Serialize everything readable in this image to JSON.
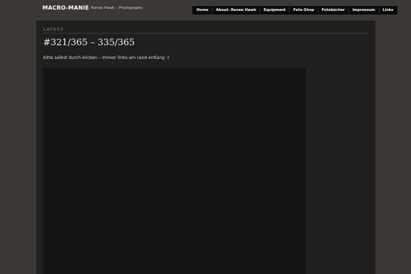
{
  "header": {
    "site_title": "MACRO-MANIE",
    "tagline": "Renee Hawk – Photography"
  },
  "nav": {
    "items": [
      {
        "label": "Home"
      },
      {
        "label": "About: Renee Hawk"
      },
      {
        "label": "Equipment"
      },
      {
        "label": "Foto-Shop"
      },
      {
        "label": "Fotobücher"
      },
      {
        "label": "Impressum"
      },
      {
        "label": "Links"
      }
    ]
  },
  "main": {
    "section_label": "LATEST",
    "post_title": "#321/365 – 335/365",
    "post_text": "bitte selbst durch klicken – immer links am rand entlang :)"
  },
  "colors": {
    "background": "#3a3735",
    "panel": "#1f1f1e",
    "nav_bg": "#0c0c0c"
  }
}
